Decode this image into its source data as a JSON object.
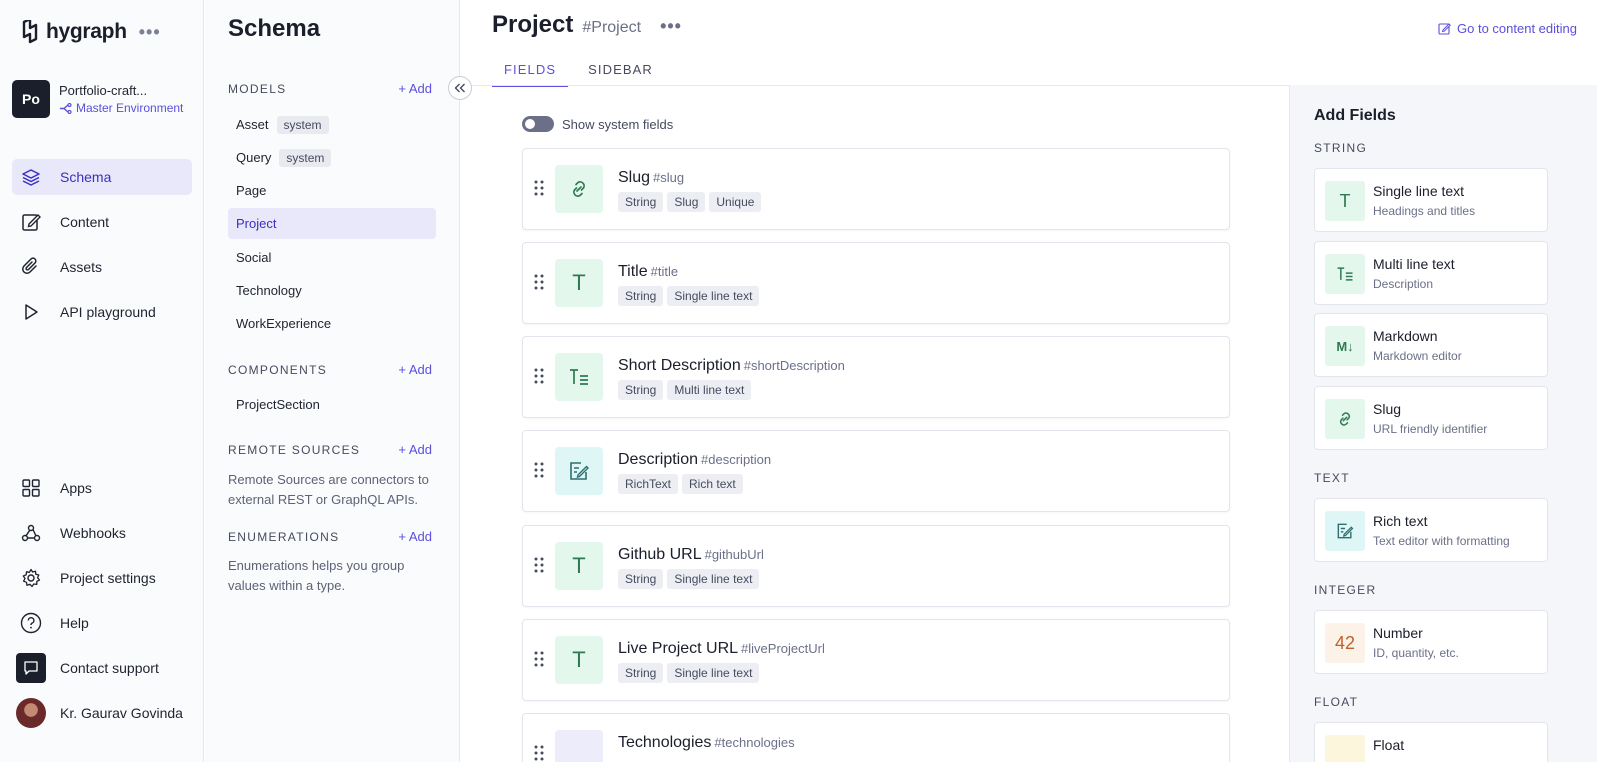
{
  "brand": {
    "name": "hygraph",
    "menu_dots": "•••"
  },
  "project": {
    "avatar": "Po",
    "name": "Portfolio-craft...",
    "environment": "Master Environment"
  },
  "nav": {
    "main": [
      {
        "label": "Schema",
        "icon": "layers-icon"
      },
      {
        "label": "Content",
        "icon": "edit-icon"
      },
      {
        "label": "Assets",
        "icon": "paperclip-icon"
      },
      {
        "label": "API playground",
        "icon": "play-icon"
      }
    ],
    "bottom": [
      {
        "label": "Apps",
        "icon": "grid-icon"
      },
      {
        "label": "Webhooks",
        "icon": "webhook-icon"
      },
      {
        "label": "Project settings",
        "icon": "gear-icon"
      },
      {
        "label": "Help",
        "icon": "help-icon"
      },
      {
        "label": "Contact support",
        "icon": "chat-icon"
      },
      {
        "label": "Kr. Gaurav Govinda",
        "icon": "avatar"
      }
    ]
  },
  "schema": {
    "title": "Schema",
    "add_label": "Add",
    "models_heading": "MODELS",
    "models": [
      {
        "name": "Asset",
        "tag": "system"
      },
      {
        "name": "Query",
        "tag": "system"
      },
      {
        "name": "Page",
        "tag": ""
      },
      {
        "name": "Project",
        "tag": ""
      },
      {
        "name": "Social",
        "tag": ""
      },
      {
        "name": "Technology",
        "tag": ""
      },
      {
        "name": "WorkExperience",
        "tag": ""
      }
    ],
    "components_heading": "COMPONENTS",
    "components": [
      "ProjectSection"
    ],
    "remote_heading": "REMOTE SOURCES",
    "remote_desc": "Remote Sources are connectors to external REST or GraphQL APIs.",
    "enum_heading": "ENUMERATIONS",
    "enum_desc": "Enumerations helps you group values within a type."
  },
  "page": {
    "title": "Project",
    "hash": "#Project",
    "more": "•••",
    "goto_label": "Go to content editing",
    "tabs": [
      "FIELDS",
      "SIDEBAR"
    ],
    "show_system_fields": "Show system fields"
  },
  "fields": [
    {
      "name": "Slug",
      "api": "#slug",
      "icon": "link-icon",
      "tags": [
        "String",
        "Slug",
        "Unique"
      ]
    },
    {
      "name": "Title",
      "api": "#title",
      "icon": "T",
      "tags": [
        "String",
        "Single line text"
      ]
    },
    {
      "name": "Short Description",
      "api": "#shortDescription",
      "icon": "multiline-icon",
      "tags": [
        "String",
        "Multi line text"
      ]
    },
    {
      "name": "Description",
      "api": "#description",
      "icon": "richtext-icon",
      "tags": [
        "RichText",
        "Rich text"
      ]
    },
    {
      "name": "Github URL",
      "api": "#githubUrl",
      "icon": "T",
      "tags": [
        "String",
        "Single line text"
      ]
    },
    {
      "name": "Live Project URL",
      "api": "#liveProjectUrl",
      "icon": "T",
      "tags": [
        "String",
        "Single line text"
      ]
    },
    {
      "name": "Technologies",
      "api": "#technologies",
      "icon": "reference-icon",
      "tags": []
    }
  ],
  "add_fields": {
    "title": "Add Fields",
    "categories": {
      "string": "STRING",
      "text": "TEXT",
      "integer": "INTEGER",
      "float": "FLOAT"
    },
    "cards": [
      {
        "title": "Single line text",
        "subtitle": "Headings and titles",
        "icon": "T"
      },
      {
        "title": "Multi line text",
        "subtitle": "Description",
        "icon": "multiline-icon"
      },
      {
        "title": "Markdown",
        "subtitle": "Markdown editor",
        "icon": "M↓"
      },
      {
        "title": "Slug",
        "subtitle": "URL friendly identifier",
        "icon": "link-icon"
      },
      {
        "title": "Rich text",
        "subtitle": "Text editor with formatting",
        "icon": "richtext-icon"
      },
      {
        "title": "Number",
        "subtitle": "ID, quantity, etc.",
        "icon": "42"
      },
      {
        "title": "Float",
        "subtitle": "",
        "icon": "float-icon"
      }
    ]
  }
}
